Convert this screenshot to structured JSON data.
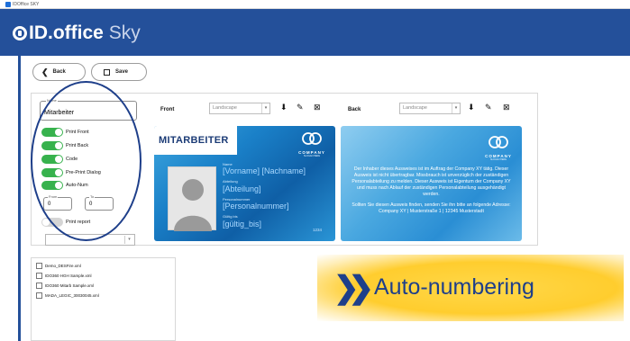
{
  "window": {
    "title": "IDOffice SKY"
  },
  "app": {
    "logo_main": "ID.office",
    "logo_sky": "Sky"
  },
  "toolbar": {
    "back_label": "Back",
    "save_label": "Save"
  },
  "settings": {
    "name_label": "Name",
    "name_value": "Mitarbeiter",
    "toggles": [
      {
        "label": "Print Front",
        "on": true
      },
      {
        "label": "Print Back",
        "on": true
      },
      {
        "label": "Code",
        "on": true
      },
      {
        "label": "Pre-Print Dialog",
        "on": true
      },
      {
        "label": "Auto-Num",
        "on": true
      }
    ],
    "from_label": "From",
    "from_value": "0",
    "to_label": "To",
    "to_value": "0",
    "print_report_label": "Print report",
    "print_report_on": false
  },
  "front": {
    "label": "Front",
    "orientation": "Landscape"
  },
  "back": {
    "label": "Back",
    "orientation": "Landscape"
  },
  "card_front": {
    "title": "MITARBEITER",
    "company": "COMPANY",
    "company_sub": "SLOGAN HERE",
    "fields": [
      {
        "label": "Name",
        "value": "[Vorname] [Nachname]"
      },
      {
        "label": "Abteilung",
        "value": "[Abteilung]"
      },
      {
        "label": "Personalnummer",
        "value": "[Personalnummer]"
      },
      {
        "label": "Gültig bis",
        "value": "[gültig_bis]"
      }
    ],
    "number": "1234"
  },
  "card_back": {
    "company": "COMPANY",
    "company_sub": "SLOGAN HERE",
    "text1": "Der Inhaber dieses Ausweises ist im Auftrag der Company XY tätig. Dieser Ausweis ist nicht übertragbar. Missbrauch ist unverzüglich der zuständigen Personalabteilung zu melden. Dieser Ausweis ist Eigentum der Company XY und muss nach Ablauf der zuständigen Personalabteilung ausgehändigt werden.",
    "text2": "Sollten Sie diesen Ausweis finden, senden Sie ihn bitte an folgende Adresse:",
    "text3": "Company XY | Musterstraße 1 | 12345 Musterstadt"
  },
  "files": [
    "Demo_DESFire.xml",
    "IDO360 HGH Sample.xml",
    "IDO360 Mitarb Sample.xml",
    "MADA_LEGIC_30030045.xml"
  ],
  "banner": {
    "chevron": "❯❯",
    "text": "Auto-numbering"
  },
  "colors": {
    "header": "#24509a",
    "toggle_on": "#37b24d",
    "banner": "#ffcd2e",
    "accent": "#1e3f8a"
  }
}
